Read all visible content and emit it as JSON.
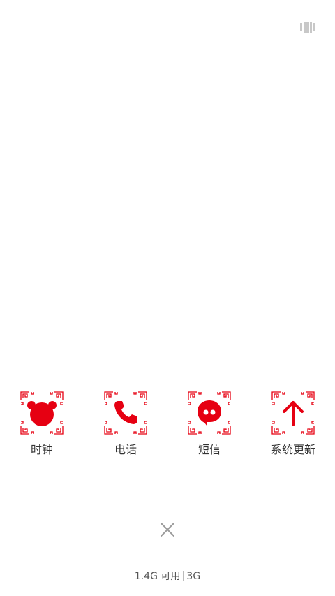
{
  "accent_color": "#e60012",
  "top_icon": "recent-apps-icon",
  "apps": [
    {
      "label": "时钟",
      "icon": "alarm-clock-icon"
    },
    {
      "label": "电话",
      "icon": "phone-icon"
    },
    {
      "label": "短信",
      "icon": "message-icon"
    },
    {
      "label": "系统更新",
      "icon": "arrow-up-icon"
    }
  ],
  "close_icon": "close-icon",
  "storage": {
    "available": "1.4G 可用",
    "network": "3G"
  }
}
